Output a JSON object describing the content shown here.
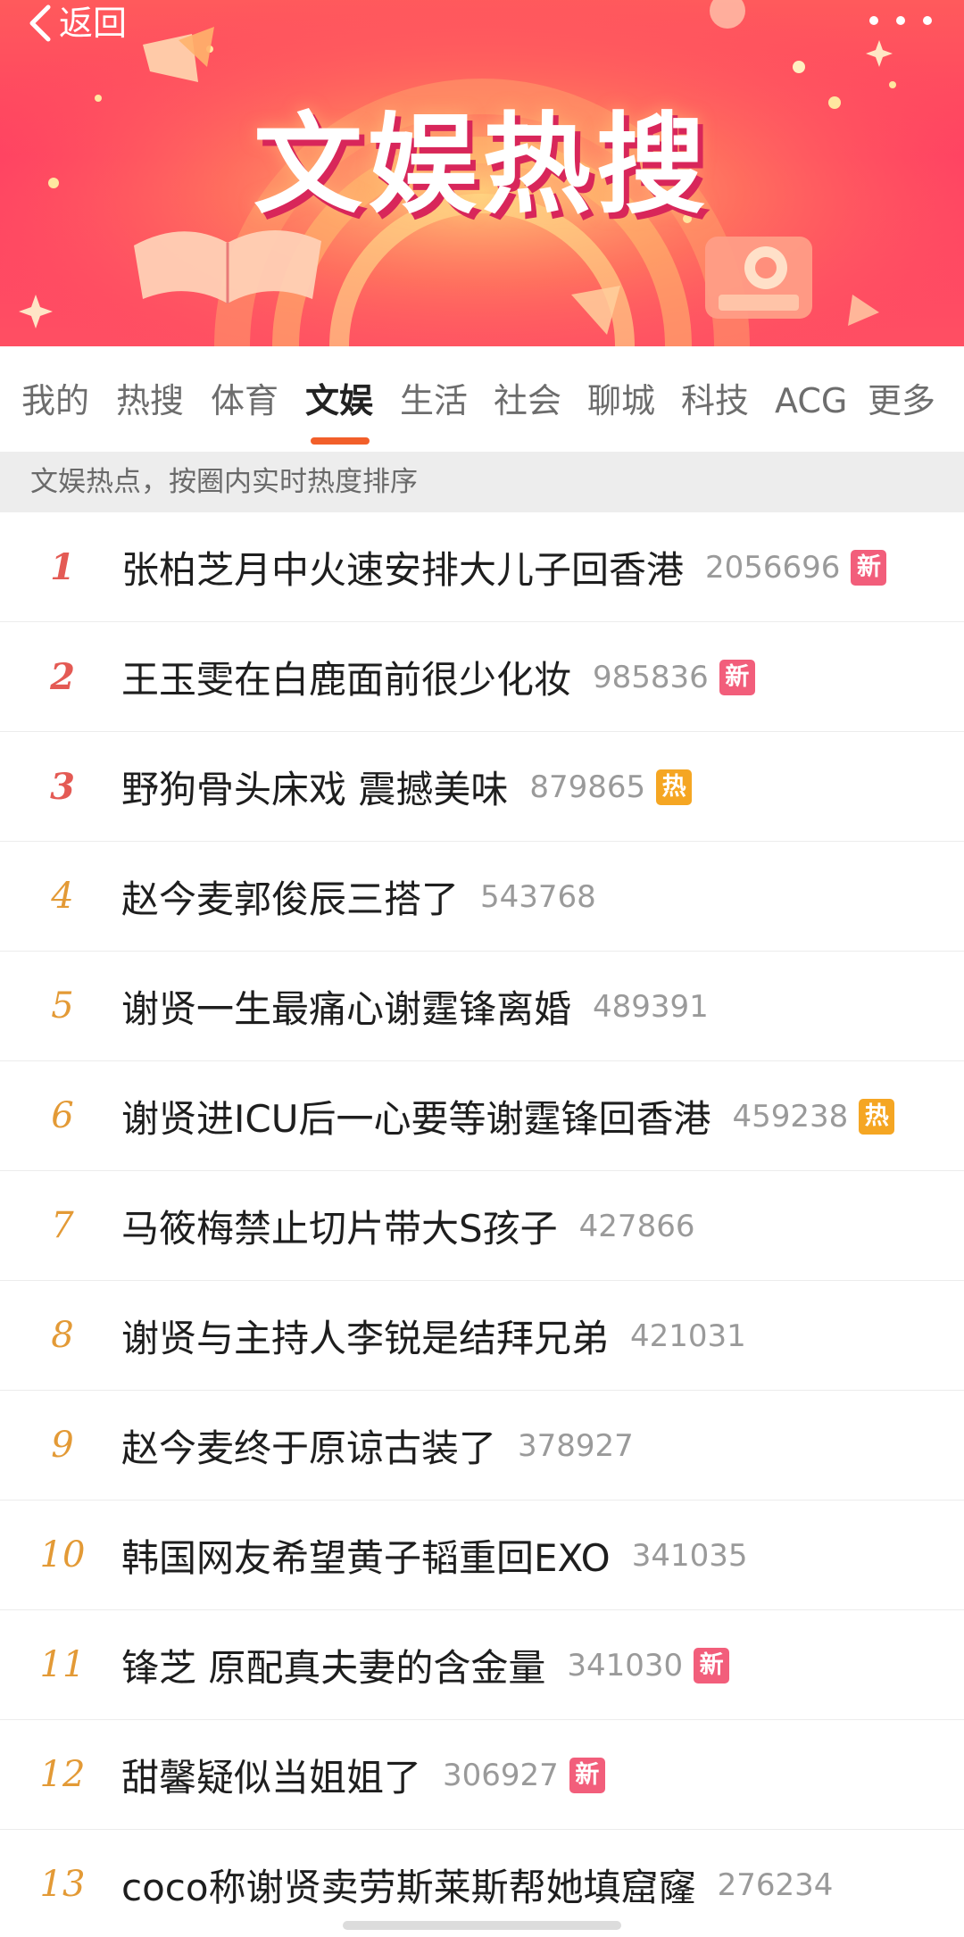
{
  "header": {
    "back_label": "返回",
    "title": "文娱热搜"
  },
  "tabs": [
    {
      "label": "我的",
      "active": false
    },
    {
      "label": "热搜",
      "active": false
    },
    {
      "label": "体育",
      "active": false
    },
    {
      "label": "文娱",
      "active": true
    },
    {
      "label": "生活",
      "active": false
    },
    {
      "label": "社会",
      "active": false
    },
    {
      "label": "聊城",
      "active": false
    },
    {
      "label": "科技",
      "active": false
    },
    {
      "label": "ACG",
      "active": false
    },
    {
      "label": "更多",
      "active": false
    }
  ],
  "subheader": "文娱热点，按圈内实时热度排序",
  "colors": {
    "accent": "#f25f2a",
    "rank_top": "#e45a54",
    "rank_normal": "#e39a36",
    "badge_new": "#f25e7b",
    "badge_hot": "#f5a623"
  },
  "items": [
    {
      "rank": "1",
      "title": "张柏芝月中火速安排大儿子回香港",
      "heat": "2056696",
      "badge": "新"
    },
    {
      "rank": "2",
      "title": "王玉雯在白鹿面前很少化妆",
      "heat": "985836",
      "badge": "新"
    },
    {
      "rank": "3",
      "title": "野狗骨头床戏 震撼美味",
      "heat": "879865",
      "badge": "热"
    },
    {
      "rank": "4",
      "title": "赵今麦郭俊辰三搭了",
      "heat": "543768",
      "badge": ""
    },
    {
      "rank": "5",
      "title": "谢贤一生最痛心谢霆锋离婚",
      "heat": "489391",
      "badge": ""
    },
    {
      "rank": "6",
      "title": "谢贤进ICU后一心要等谢霆锋回香港",
      "heat": "459238",
      "badge": "热"
    },
    {
      "rank": "7",
      "title": "马筱梅禁止切片带大S孩子",
      "heat": "427866",
      "badge": ""
    },
    {
      "rank": "8",
      "title": "谢贤与主持人李锐是结拜兄弟",
      "heat": "421031",
      "badge": ""
    },
    {
      "rank": "9",
      "title": "赵今麦终于原谅古装了",
      "heat": "378927",
      "badge": ""
    },
    {
      "rank": "10",
      "title": "韩国网友希望黄子韬重回EXO",
      "heat": "341035",
      "badge": ""
    },
    {
      "rank": "11",
      "title": "锋芝 原配真夫妻的含金量",
      "heat": "341030",
      "badge": "新"
    },
    {
      "rank": "12",
      "title": "甜馨疑似当姐姐了",
      "heat": "306927",
      "badge": "新"
    },
    {
      "rank": "13",
      "title": "coco称谢贤卖劳斯莱斯帮她填窟窿",
      "heat": "276234",
      "badge": ""
    }
  ]
}
